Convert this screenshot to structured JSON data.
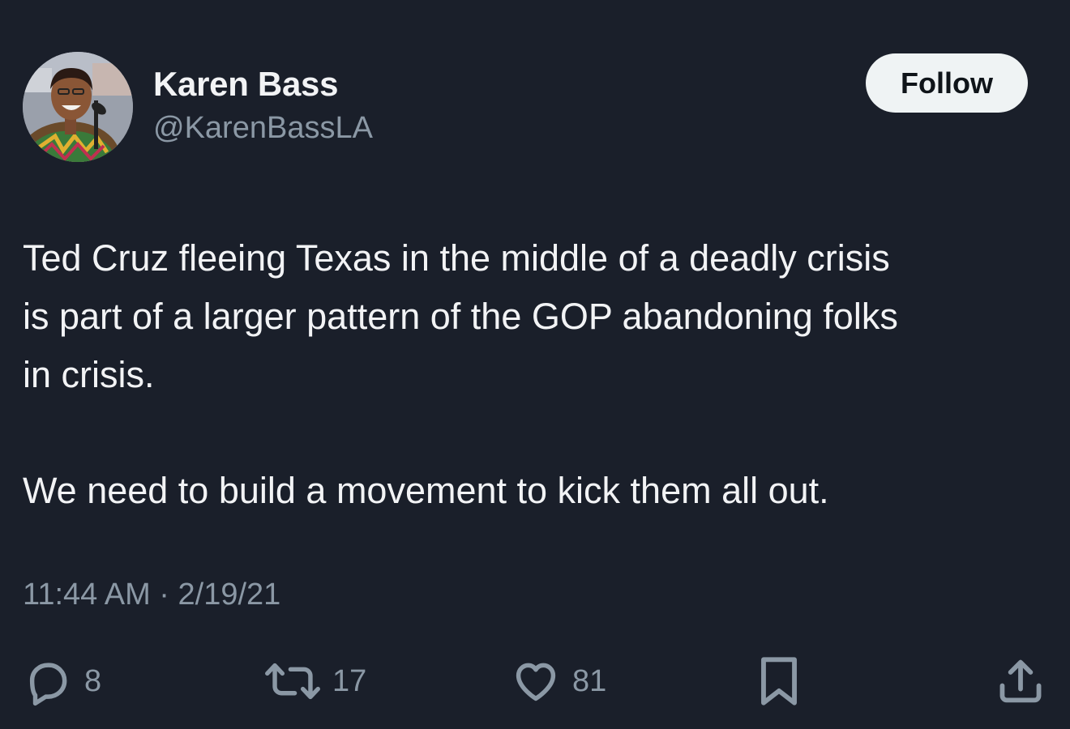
{
  "author": {
    "name": "Karen Bass",
    "handle": "@KarenBassLA",
    "avatar_icon": "profile-photo"
  },
  "follow_label": "Follow",
  "tweet": {
    "lines": [
      "Ted Cruz fleeing Texas in the middle of a deadly crisis",
      "is part of a larger pattern of the GOP abandoning folks",
      "in crisis.",
      "We need to build a movement to kick them all out."
    ]
  },
  "timestamp": "11:44 AM · 2/19/21",
  "actions": {
    "reply": {
      "icon": "reply-icon",
      "count": "8"
    },
    "retweet": {
      "icon": "retweet-icon",
      "count": "17"
    },
    "like": {
      "icon": "heart-icon",
      "count": "81"
    },
    "bookmark": {
      "icon": "bookmark-icon"
    },
    "share": {
      "icon": "share-icon"
    }
  },
  "colors": {
    "background": "#1a1f2a",
    "text_primary": "#f2f3f5",
    "text_secondary": "#8b98a5",
    "follow_bg": "#eff3f4"
  }
}
